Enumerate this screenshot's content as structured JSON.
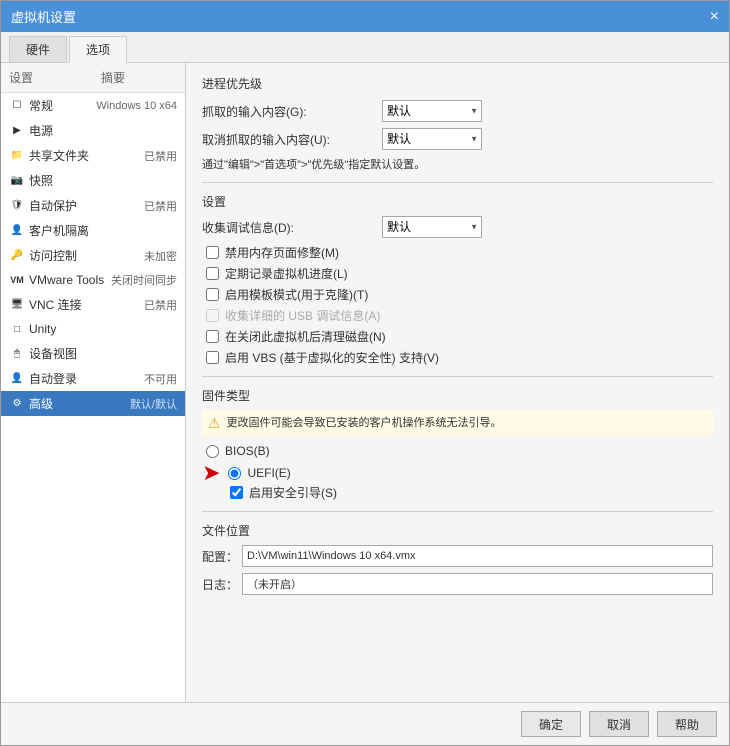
{
  "window": {
    "title": "虚拟机设置",
    "close_label": "×"
  },
  "tabs": [
    {
      "id": "hardware",
      "label": "硬件"
    },
    {
      "id": "options",
      "label": "选项",
      "active": true
    }
  ],
  "left_panel": {
    "headers": [
      "设置",
      "摘要"
    ],
    "items": [
      {
        "id": "general",
        "icon": "☐",
        "label": "常规",
        "value": "Windows 10 x64"
      },
      {
        "id": "power",
        "icon": "▶",
        "label": "电源",
        "value": ""
      },
      {
        "id": "shared_folder",
        "icon": "📁",
        "label": "共享文件夹",
        "value": "已禁用"
      },
      {
        "id": "snapshot",
        "icon": "📷",
        "label": "快照",
        "value": ""
      },
      {
        "id": "auto_protect",
        "icon": "🔒",
        "label": "自动保护",
        "value": "已禁用"
      },
      {
        "id": "guest_isolation",
        "icon": "👤",
        "label": "客户机隔离",
        "value": ""
      },
      {
        "id": "access_control",
        "icon": "🔑",
        "label": "访问控制",
        "value": "未加密"
      },
      {
        "id": "vmware_tools",
        "icon": "VM",
        "label": "VMware Tools",
        "value": "关闭时间同步"
      },
      {
        "id": "vnc",
        "icon": "🖥",
        "label": "VNC 连接",
        "value": "已禁用"
      },
      {
        "id": "unity",
        "icon": "□",
        "label": "Unity",
        "value": ""
      },
      {
        "id": "device_view",
        "icon": "🖱",
        "label": "设备视图",
        "value": ""
      },
      {
        "id": "auto_login",
        "icon": "👤",
        "label": "自动登录",
        "value": "不可用"
      },
      {
        "id": "advanced",
        "icon": "⚙",
        "label": "高级",
        "value": "默认/默认",
        "selected": true
      }
    ]
  },
  "right_panel": {
    "priority_section": {
      "title": "进程优先级",
      "capture_label": "抓取的输入内容(G):",
      "capture_value": "默认",
      "cancel_label": "取消抓取的输入内容(U):",
      "cancel_value": "默认",
      "note": "通过\"编辑\">\"首选项\">\"优先级\"指定默认设置。"
    },
    "settings_section": {
      "title": "设置",
      "collect_debug_label": "收集调试信息(D):",
      "collect_debug_value": "默认",
      "checkboxes": [
        {
          "id": "disable_mem_page",
          "label": "禁用内存页面修整(M)",
          "checked": false
        },
        {
          "id": "log_progress",
          "label": "定期记录虚拟机进度(L)",
          "checked": false
        },
        {
          "id": "enable_template",
          "label": "启用模板模式(用于克隆)(T)",
          "checked": false
        },
        {
          "id": "collect_usb",
          "label": "收集详细的 USB 调试信息(A)",
          "checked": false,
          "disabled": true
        },
        {
          "id": "clean_disk_off",
          "label": "在关闭此虚拟机后清理磁盘(N)",
          "checked": false
        },
        {
          "id": "vbs_support",
          "label": "启用 VBS (基于虚拟化的安全性) 支持(V)",
          "checked": false
        }
      ]
    },
    "firmware_section": {
      "title": "固件类型",
      "warning_text": "更改固件可能会导致已安装的客户机操作系统无法引导。",
      "radios": [
        {
          "id": "bios",
          "label": "BIOS(B)",
          "checked": false
        },
        {
          "id": "uefi",
          "label": "UEFI(E)",
          "checked": true
        }
      ],
      "secure_boot_label": "启用安全引导(S)",
      "secure_boot_checked": true
    },
    "file_section": {
      "title": "文件位置",
      "config_label": "配置：",
      "config_value": "D:\\VM\\win11\\Windows 10 x64.vmx",
      "log_label": "日志：",
      "log_value": "（未开启）"
    }
  },
  "bottom_buttons": [
    {
      "id": "ok",
      "label": "确定"
    },
    {
      "id": "cancel",
      "label": "取消"
    },
    {
      "id": "help",
      "label": "帮助"
    }
  ]
}
